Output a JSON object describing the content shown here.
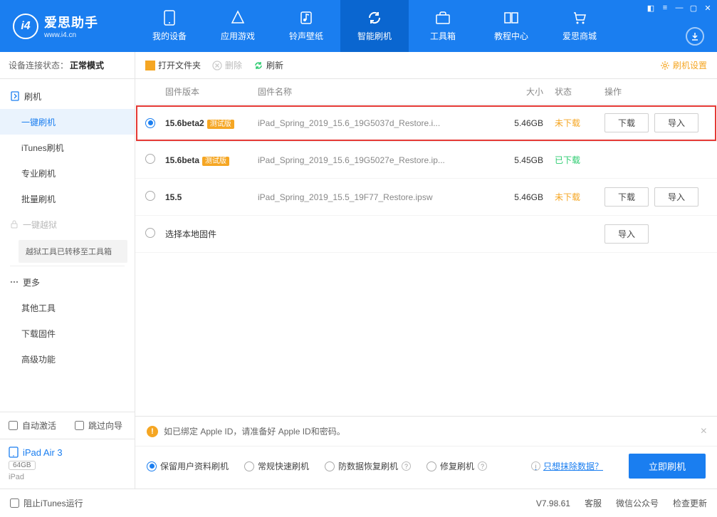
{
  "app": {
    "title": "爱思助手",
    "subtitle": "www.i4.cn"
  },
  "nav": {
    "items": [
      {
        "label": "我的设备"
      },
      {
        "label": "应用游戏"
      },
      {
        "label": "铃声壁纸"
      },
      {
        "label": "智能刷机"
      },
      {
        "label": "工具箱"
      },
      {
        "label": "教程中心"
      },
      {
        "label": "爱思商城"
      }
    ]
  },
  "sidebar": {
    "conn_label": "设备连接状态：",
    "conn_mode": "正常模式",
    "flash_root": "刷机",
    "items": [
      "一键刷机",
      "iTunes刷机",
      "专业刷机",
      "批量刷机"
    ],
    "jailbreak": "一键越狱",
    "jb_note": "越狱工具已转移至工具箱",
    "more": "更多",
    "more_items": [
      "其他工具",
      "下载固件",
      "高级功能"
    ],
    "auto_activate": "自动激活",
    "skip_guide": "跳过向导",
    "device": {
      "name": "iPad Air 3",
      "capacity": "64GB",
      "type": "iPad"
    }
  },
  "toolbar": {
    "open": "打开文件夹",
    "delete": "删除",
    "refresh": "刷新",
    "settings": "刷机设置"
  },
  "table": {
    "headers": {
      "version": "固件版本",
      "name": "固件名称",
      "size": "大小",
      "status": "状态",
      "ops": "操作"
    },
    "download": "下载",
    "import": "导入",
    "rows": [
      {
        "version": "15.6beta2",
        "beta": "测试版",
        "name": "iPad_Spring_2019_15.6_19G5037d_Restore.i...",
        "size": "5.46GB",
        "status": "未下载",
        "status_cls": "not",
        "selected": true,
        "show_ops": true,
        "hl": true
      },
      {
        "version": "15.6beta",
        "beta": "测试版",
        "name": "iPad_Spring_2019_15.6_19G5027e_Restore.ip...",
        "size": "5.45GB",
        "status": "已下载",
        "status_cls": "ok",
        "selected": false,
        "show_ops": false
      },
      {
        "version": "15.5",
        "beta": "",
        "name": "iPad_Spring_2019_15.5_19F77_Restore.ipsw",
        "size": "5.46GB",
        "status": "未下载",
        "status_cls": "not",
        "selected": false,
        "show_ops": true
      }
    ],
    "local": "选择本地固件"
  },
  "warn": {
    "text": "如已绑定 Apple ID，请准备好 Apple ID和密码。"
  },
  "opts": {
    "items": [
      "保留用户资料刷机",
      "常规快速刷机",
      "防数据恢复刷机",
      "修复刷机"
    ],
    "erase_link": "只想抹除数据？",
    "go": "立即刷机"
  },
  "footer": {
    "block_itunes": "阻止iTunes运行",
    "version": "V7.98.61",
    "support": "客服",
    "wechat": "微信公众号",
    "update": "检查更新"
  }
}
